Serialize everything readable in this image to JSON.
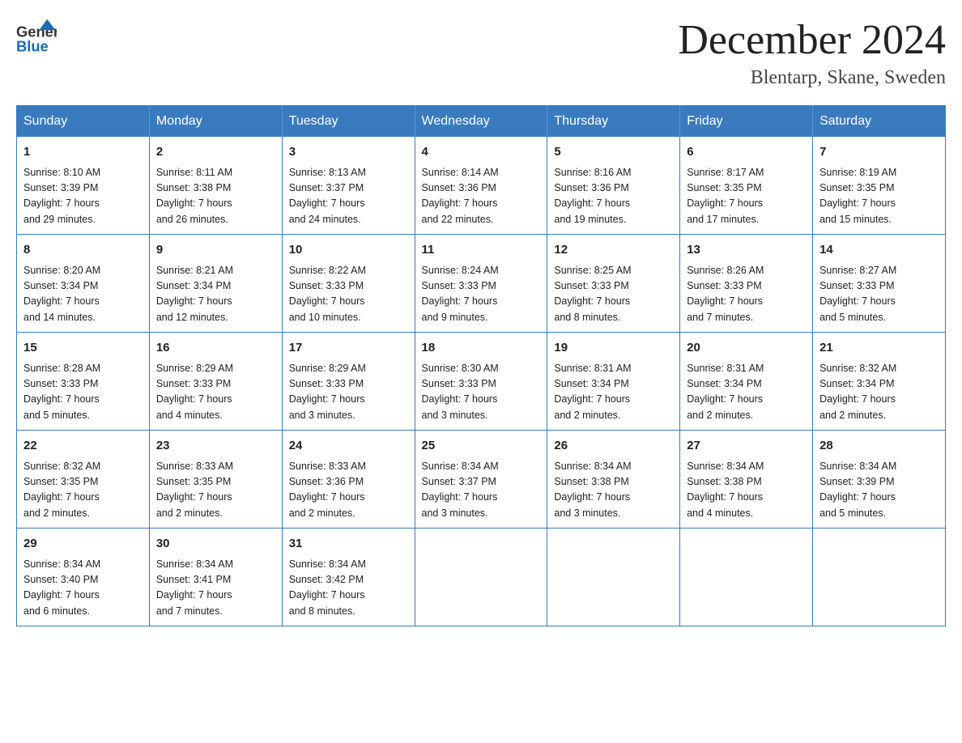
{
  "logo": {
    "general": "General",
    "blue": "Blue"
  },
  "title": {
    "month_year": "December 2024",
    "location": "Blentarp, Skane, Sweden"
  },
  "headers": [
    "Sunday",
    "Monday",
    "Tuesday",
    "Wednesday",
    "Thursday",
    "Friday",
    "Saturday"
  ],
  "weeks": [
    [
      {
        "day": "1",
        "sunrise": "Sunrise: 8:10 AM",
        "sunset": "Sunset: 3:39 PM",
        "daylight": "Daylight: 7 hours",
        "daylight2": "and 29 minutes."
      },
      {
        "day": "2",
        "sunrise": "Sunrise: 8:11 AM",
        "sunset": "Sunset: 3:38 PM",
        "daylight": "Daylight: 7 hours",
        "daylight2": "and 26 minutes."
      },
      {
        "day": "3",
        "sunrise": "Sunrise: 8:13 AM",
        "sunset": "Sunset: 3:37 PM",
        "daylight": "Daylight: 7 hours",
        "daylight2": "and 24 minutes."
      },
      {
        "day": "4",
        "sunrise": "Sunrise: 8:14 AM",
        "sunset": "Sunset: 3:36 PM",
        "daylight": "Daylight: 7 hours",
        "daylight2": "and 22 minutes."
      },
      {
        "day": "5",
        "sunrise": "Sunrise: 8:16 AM",
        "sunset": "Sunset: 3:36 PM",
        "daylight": "Daylight: 7 hours",
        "daylight2": "and 19 minutes."
      },
      {
        "day": "6",
        "sunrise": "Sunrise: 8:17 AM",
        "sunset": "Sunset: 3:35 PM",
        "daylight": "Daylight: 7 hours",
        "daylight2": "and 17 minutes."
      },
      {
        "day": "7",
        "sunrise": "Sunrise: 8:19 AM",
        "sunset": "Sunset: 3:35 PM",
        "daylight": "Daylight: 7 hours",
        "daylight2": "and 15 minutes."
      }
    ],
    [
      {
        "day": "8",
        "sunrise": "Sunrise: 8:20 AM",
        "sunset": "Sunset: 3:34 PM",
        "daylight": "Daylight: 7 hours",
        "daylight2": "and 14 minutes."
      },
      {
        "day": "9",
        "sunrise": "Sunrise: 8:21 AM",
        "sunset": "Sunset: 3:34 PM",
        "daylight": "Daylight: 7 hours",
        "daylight2": "and 12 minutes."
      },
      {
        "day": "10",
        "sunrise": "Sunrise: 8:22 AM",
        "sunset": "Sunset: 3:33 PM",
        "daylight": "Daylight: 7 hours",
        "daylight2": "and 10 minutes."
      },
      {
        "day": "11",
        "sunrise": "Sunrise: 8:24 AM",
        "sunset": "Sunset: 3:33 PM",
        "daylight": "Daylight: 7 hours",
        "daylight2": "and 9 minutes."
      },
      {
        "day": "12",
        "sunrise": "Sunrise: 8:25 AM",
        "sunset": "Sunset: 3:33 PM",
        "daylight": "Daylight: 7 hours",
        "daylight2": "and 8 minutes."
      },
      {
        "day": "13",
        "sunrise": "Sunrise: 8:26 AM",
        "sunset": "Sunset: 3:33 PM",
        "daylight": "Daylight: 7 hours",
        "daylight2": "and 7 minutes."
      },
      {
        "day": "14",
        "sunrise": "Sunrise: 8:27 AM",
        "sunset": "Sunset: 3:33 PM",
        "daylight": "Daylight: 7 hours",
        "daylight2": "and 5 minutes."
      }
    ],
    [
      {
        "day": "15",
        "sunrise": "Sunrise: 8:28 AM",
        "sunset": "Sunset: 3:33 PM",
        "daylight": "Daylight: 7 hours",
        "daylight2": "and 5 minutes."
      },
      {
        "day": "16",
        "sunrise": "Sunrise: 8:29 AM",
        "sunset": "Sunset: 3:33 PM",
        "daylight": "Daylight: 7 hours",
        "daylight2": "and 4 minutes."
      },
      {
        "day": "17",
        "sunrise": "Sunrise: 8:29 AM",
        "sunset": "Sunset: 3:33 PM",
        "daylight": "Daylight: 7 hours",
        "daylight2": "and 3 minutes."
      },
      {
        "day": "18",
        "sunrise": "Sunrise: 8:30 AM",
        "sunset": "Sunset: 3:33 PM",
        "daylight": "Daylight: 7 hours",
        "daylight2": "and 3 minutes."
      },
      {
        "day": "19",
        "sunrise": "Sunrise: 8:31 AM",
        "sunset": "Sunset: 3:34 PM",
        "daylight": "Daylight: 7 hours",
        "daylight2": "and 2 minutes."
      },
      {
        "day": "20",
        "sunrise": "Sunrise: 8:31 AM",
        "sunset": "Sunset: 3:34 PM",
        "daylight": "Daylight: 7 hours",
        "daylight2": "and 2 minutes."
      },
      {
        "day": "21",
        "sunrise": "Sunrise: 8:32 AM",
        "sunset": "Sunset: 3:34 PM",
        "daylight": "Daylight: 7 hours",
        "daylight2": "and 2 minutes."
      }
    ],
    [
      {
        "day": "22",
        "sunrise": "Sunrise: 8:32 AM",
        "sunset": "Sunset: 3:35 PM",
        "daylight": "Daylight: 7 hours",
        "daylight2": "and 2 minutes."
      },
      {
        "day": "23",
        "sunrise": "Sunrise: 8:33 AM",
        "sunset": "Sunset: 3:35 PM",
        "daylight": "Daylight: 7 hours",
        "daylight2": "and 2 minutes."
      },
      {
        "day": "24",
        "sunrise": "Sunrise: 8:33 AM",
        "sunset": "Sunset: 3:36 PM",
        "daylight": "Daylight: 7 hours",
        "daylight2": "and 2 minutes."
      },
      {
        "day": "25",
        "sunrise": "Sunrise: 8:34 AM",
        "sunset": "Sunset: 3:37 PM",
        "daylight": "Daylight: 7 hours",
        "daylight2": "and 3 minutes."
      },
      {
        "day": "26",
        "sunrise": "Sunrise: 8:34 AM",
        "sunset": "Sunset: 3:38 PM",
        "daylight": "Daylight: 7 hours",
        "daylight2": "and 3 minutes."
      },
      {
        "day": "27",
        "sunrise": "Sunrise: 8:34 AM",
        "sunset": "Sunset: 3:38 PM",
        "daylight": "Daylight: 7 hours",
        "daylight2": "and 4 minutes."
      },
      {
        "day": "28",
        "sunrise": "Sunrise: 8:34 AM",
        "sunset": "Sunset: 3:39 PM",
        "daylight": "Daylight: 7 hours",
        "daylight2": "and 5 minutes."
      }
    ],
    [
      {
        "day": "29",
        "sunrise": "Sunrise: 8:34 AM",
        "sunset": "Sunset: 3:40 PM",
        "daylight": "Daylight: 7 hours",
        "daylight2": "and 6 minutes."
      },
      {
        "day": "30",
        "sunrise": "Sunrise: 8:34 AM",
        "sunset": "Sunset: 3:41 PM",
        "daylight": "Daylight: 7 hours",
        "daylight2": "and 7 minutes."
      },
      {
        "day": "31",
        "sunrise": "Sunrise: 8:34 AM",
        "sunset": "Sunset: 3:42 PM",
        "daylight": "Daylight: 7 hours",
        "daylight2": "and 8 minutes."
      },
      null,
      null,
      null,
      null
    ]
  ]
}
